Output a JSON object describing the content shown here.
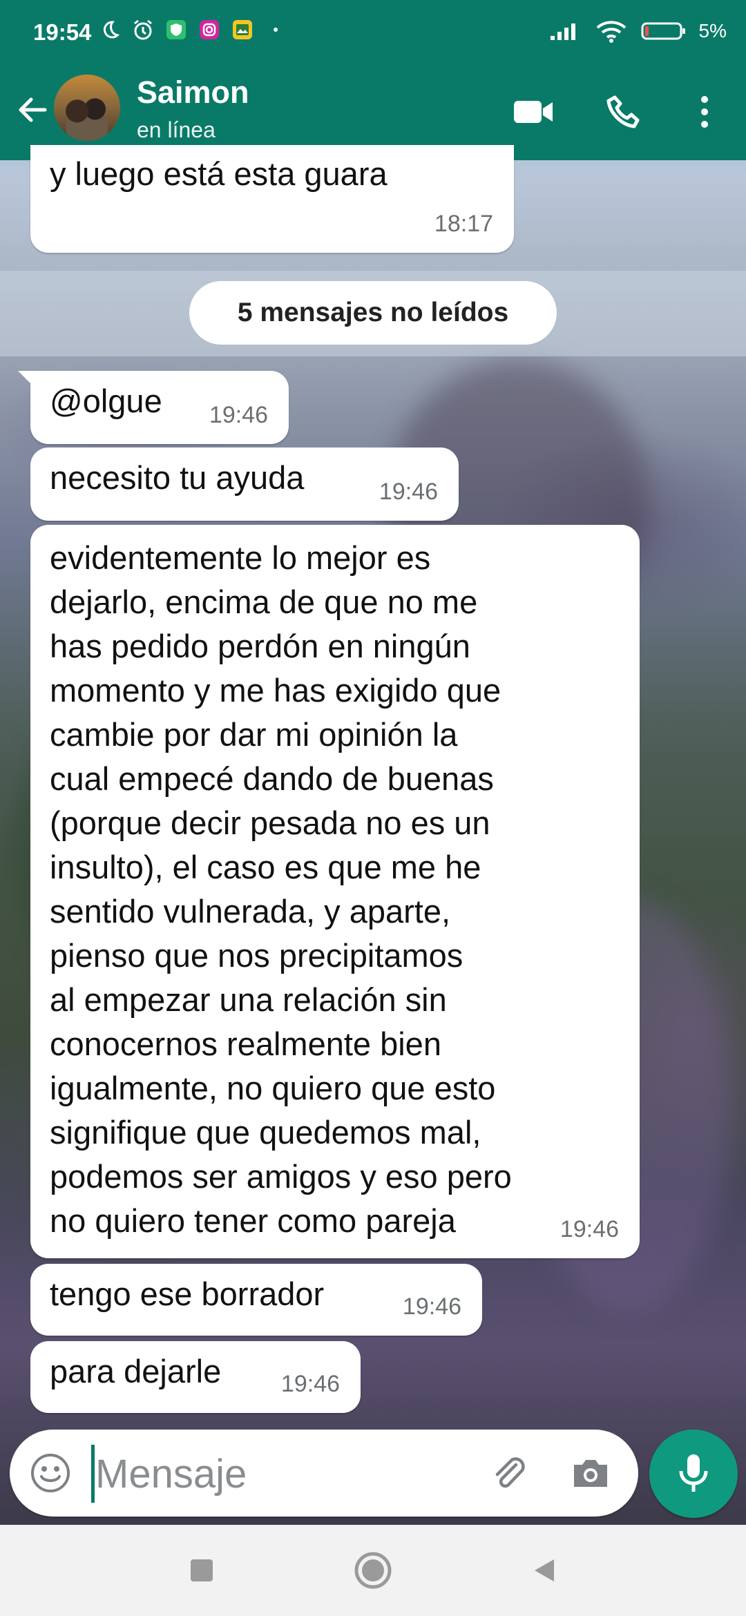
{
  "status_bar": {
    "time": "19:54",
    "battery": "5%",
    "icons": [
      "moon-icon",
      "alarm-icon",
      "shield-icon",
      "instagram-icon",
      "gallery-icon",
      "dot-icon",
      "signal-icon",
      "wifi-icon",
      "battery-icon"
    ]
  },
  "header": {
    "contact_name": "Saimon",
    "contact_status": "en línea",
    "icons": [
      "back-arrow-icon",
      "video-call-icon",
      "phone-icon",
      "more-vert-icon"
    ]
  },
  "unread_divider": "5 mensajes no leídos",
  "messages": [
    {
      "text": "y luego está esta guara",
      "time": "18:17"
    },
    {
      "text": "@olgue",
      "time": "19:46"
    },
    {
      "text": "necesito tu ayuda",
      "time": "19:46"
    },
    {
      "text": "evidentemente lo mejor es\ndejarlo, encima de que no me\nhas pedido perdón en ningún\nmomento y me has exigido que\ncambie por dar mi opinión la\ncual empecé dando de buenas\n(porque decir pesada no es un\ninsulto), el caso es que me he\nsentido vulnerada, y aparte,\npienso que nos precipitamos\nal empezar una relación sin\nconocernos realmente bien\nigualmente, no quiero que esto\nsignifique que quedemos mal,\npodemos ser amigos y eso pero\nno quiero tener como pareja",
      "time": "19:46"
    },
    {
      "text": "tengo ese borrador",
      "time": "19:46"
    },
    {
      "text": "para dejarle",
      "time": "19:46"
    }
  ],
  "input": {
    "placeholder": "Mensaje",
    "value": "",
    "icons": [
      "emoji-icon",
      "attach-icon",
      "camera-icon",
      "mic-icon"
    ]
  },
  "nav": {
    "icons": [
      "recents-icon",
      "home-icon",
      "back-triangle-icon"
    ]
  },
  "colors": {
    "header": "#0a7a68",
    "mic_button": "#0f9a80",
    "bubble": "#ffffff"
  }
}
